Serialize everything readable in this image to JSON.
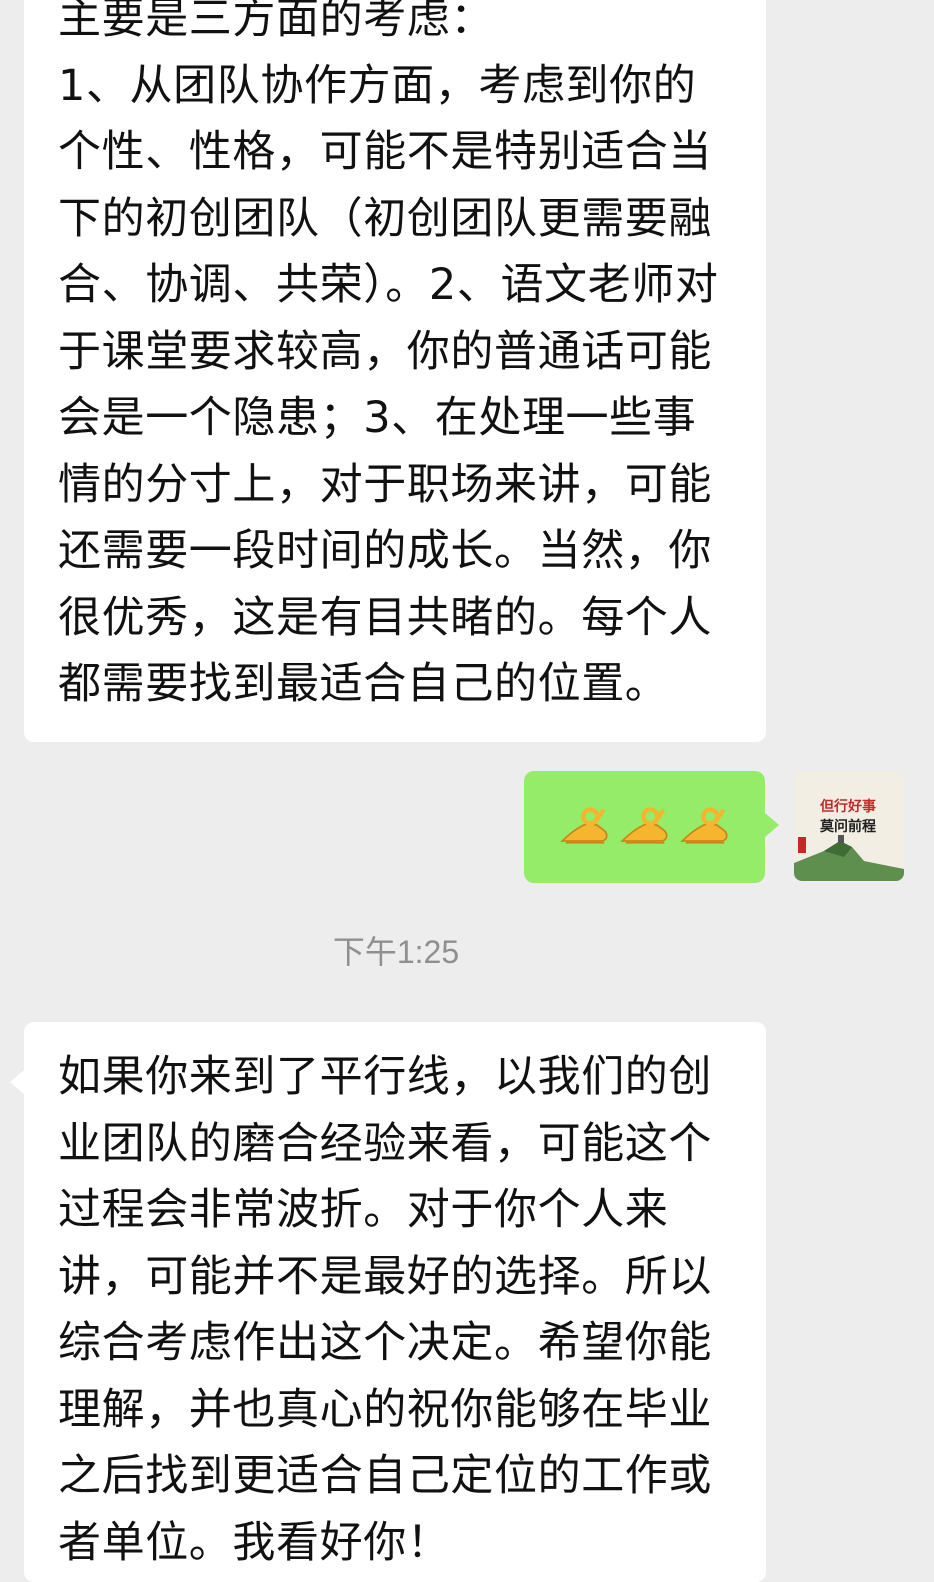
{
  "messages": [
    {
      "side": "left",
      "text": "主要是三方面的考虑：\n1、从团队协作方面，考虑到你的个性、性格，可能不是特别适合当下的初创团队（初创团队更需要融合、协调、共荣）。2、语文老师对于课堂要求较高，你的普通话可能会是一个隐患；3、在处理一些事情的分寸上，对于职场来讲，可能还需要一段时间的成长。当然，你很优秀，这是有目共睹的。每个人都需要找到最适合自己的位置。"
    },
    {
      "side": "right",
      "emoji_name": "ok-hand-emoji",
      "emoji_count": 3
    },
    {
      "side": "left",
      "text": "如果你来到了平行线，以我们的创业团队的磨合经验来看，可能这个过程会非常波折。对于你个人来讲，可能并不是最好的选择。所以综合考虑作出这个决定。希望你能理解，并也真心的祝你能够在毕业之后找到更适合自己定位的工作或者单位。我看好你！"
    }
  ],
  "timestamp": "下午1:25",
  "avatar": {
    "icon": "landscape-avatar",
    "text_line1": "但行好事",
    "text_line2": "莫问前程"
  },
  "colors": {
    "background": "#ededed",
    "incoming_bubble": "#ffffff",
    "outgoing_bubble": "#95ec69",
    "timestamp": "#8f8f8f"
  }
}
